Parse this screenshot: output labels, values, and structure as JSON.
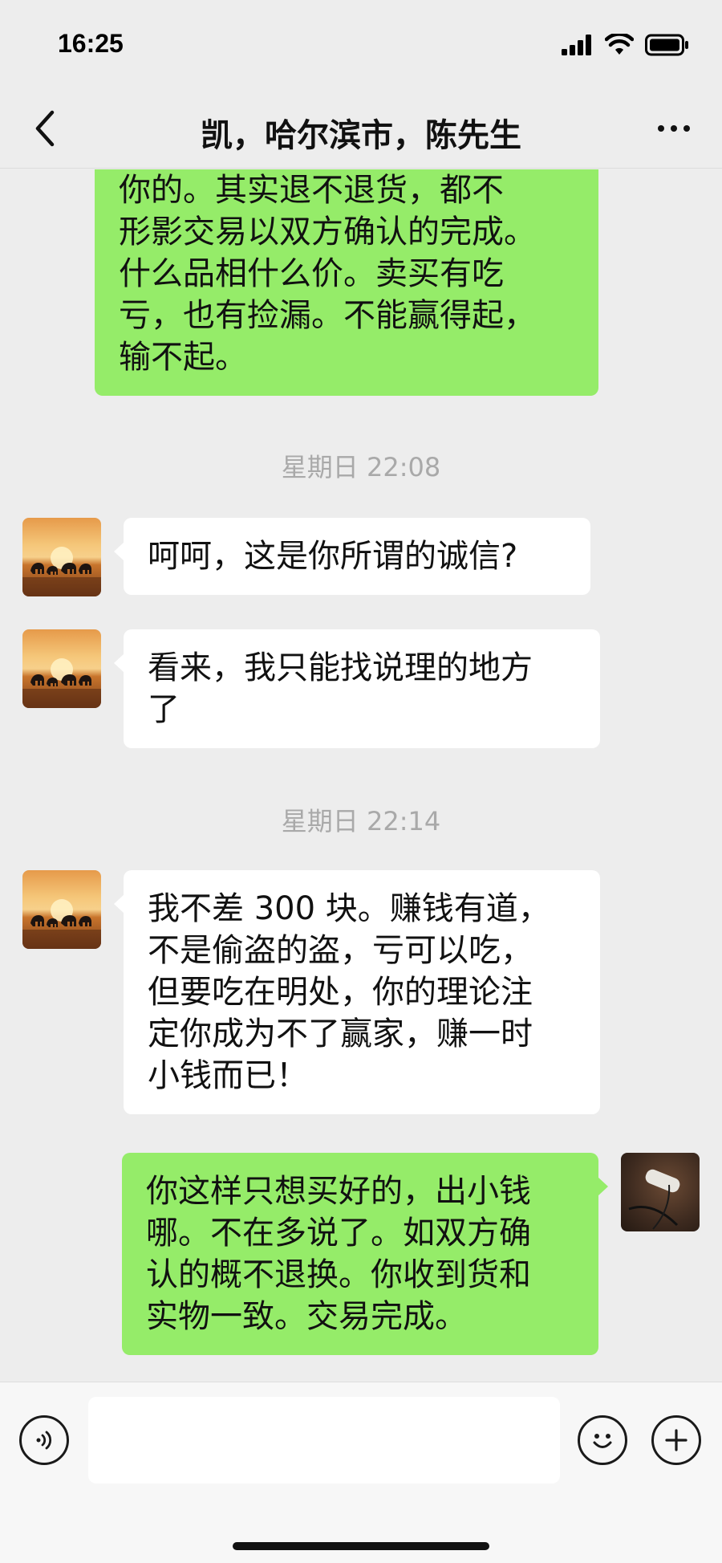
{
  "status_bar": {
    "time": "16:25",
    "icons": [
      "signal-icon",
      "wifi-icon",
      "battery-icon"
    ]
  },
  "nav": {
    "title": "凯，哈尔滨市，陈先生",
    "back_icon": "chevron-left-icon",
    "more_icon": "more-icon"
  },
  "messages": [
    {
      "sender": "me",
      "lines": [
        "你的。其实退不退货，都不",
        "形影交易以双方确认的完成。",
        "什么品相什么价。卖买有吃",
        "亏，也有捡漏。不能赢得起，",
        "输不起。"
      ]
    },
    {
      "type": "timestamp",
      "text": "星期日 22:08"
    },
    {
      "sender": "other",
      "lines": [
        "呵呵，这是你所谓的诚信?"
      ]
    },
    {
      "sender": "other",
      "lines": [
        "看来，我只能找说理的地方",
        "了"
      ]
    },
    {
      "type": "timestamp",
      "text": "星期日 22:14"
    },
    {
      "sender": "other",
      "lines": [
        "我不差 300 块。赚钱有道，",
        "不是偷盗的盗，亏可以吃，",
        "但要吃在明处，你的理论注",
        "定你成为不了赢家，赚一时",
        "小钱而已！"
      ]
    },
    {
      "sender": "me",
      "lines": [
        "你这样只想买好的，出小钱",
        "哪。不在多说了。如双方确",
        "认的概不退换。你收到货和",
        "实物一致。交易完成。"
      ]
    }
  ],
  "input_bar": {
    "value": "",
    "voice_icon": "voice-icon",
    "emoji_icon": "emoji-icon",
    "plus_icon": "plus-icon"
  },
  "colors": {
    "background": "#ededed",
    "my_bubble": "#95ec69",
    "other_bubble": "#ffffff",
    "timestamp": "#a9a9a9"
  }
}
